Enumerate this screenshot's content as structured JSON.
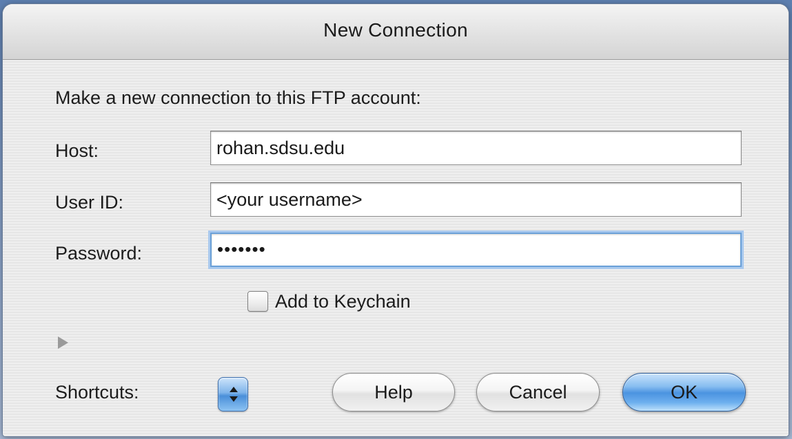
{
  "window": {
    "title": "New Connection"
  },
  "dialog": {
    "prompt": "Make a new connection to this FTP account:",
    "host": {
      "label": "Host:",
      "value": "rohan.sdsu.edu"
    },
    "user_id": {
      "label": "User ID:",
      "value": "<your username>"
    },
    "password": {
      "label": "Password:",
      "masked_value": "•••••••"
    },
    "keychain": {
      "label": "Add to Keychain",
      "checked": false
    },
    "shortcuts": {
      "label": "Shortcuts:"
    }
  },
  "buttons": {
    "help": "Help",
    "cancel": "Cancel",
    "ok": "OK"
  },
  "icons": {
    "disclosure": "disclosure-triangle-icon",
    "stepper": "popup-stepper-icon"
  },
  "colors": {
    "default_button": "#4b93e0",
    "focus_ring": "#6aa0d8"
  }
}
